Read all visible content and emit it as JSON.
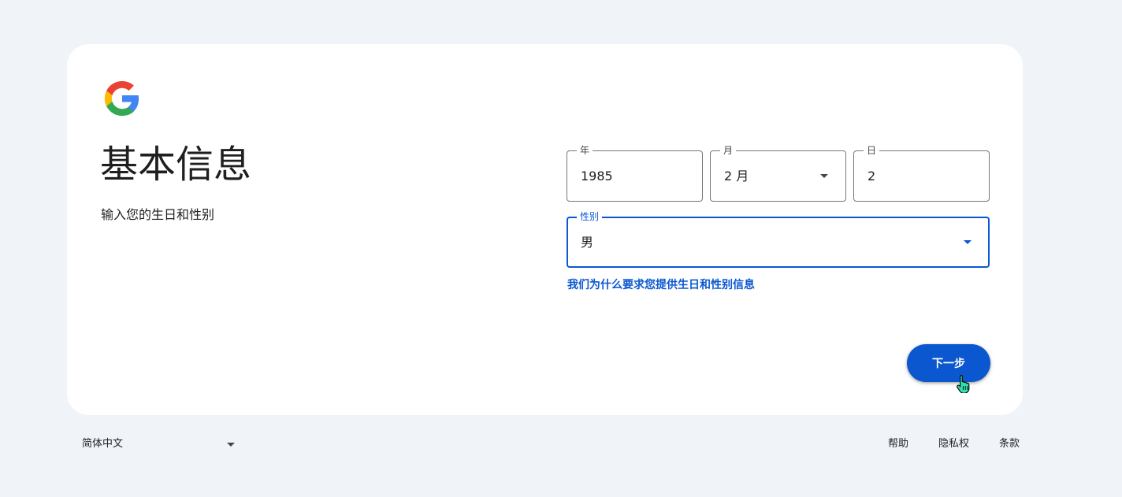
{
  "header": {
    "title": "基本信息",
    "subtitle": "输入您的生日和性别"
  },
  "birthday": {
    "year": {
      "label": "年",
      "value": "1985"
    },
    "month": {
      "label": "月",
      "value": "2 月"
    },
    "day": {
      "label": "日",
      "value": "2"
    }
  },
  "gender": {
    "label": "性别",
    "value": "男"
  },
  "why_link": "我们为什么要求您提供生日和性别信息",
  "next_button": "下一步",
  "footer": {
    "language": "简体中文",
    "links": [
      "帮助",
      "隐私权",
      "条款"
    ]
  },
  "colors": {
    "page_background": "#f0f4f9",
    "card_background": "#ffffff",
    "accent": "#0b57d0",
    "google_blue": "#4285f4",
    "google_red": "#ea4335",
    "google_yellow": "#fbbc05",
    "google_green": "#34a853"
  },
  "icons": [
    "google-logo-icon",
    "chevron-down-icon",
    "hand-pointer-cursor-icon"
  ]
}
